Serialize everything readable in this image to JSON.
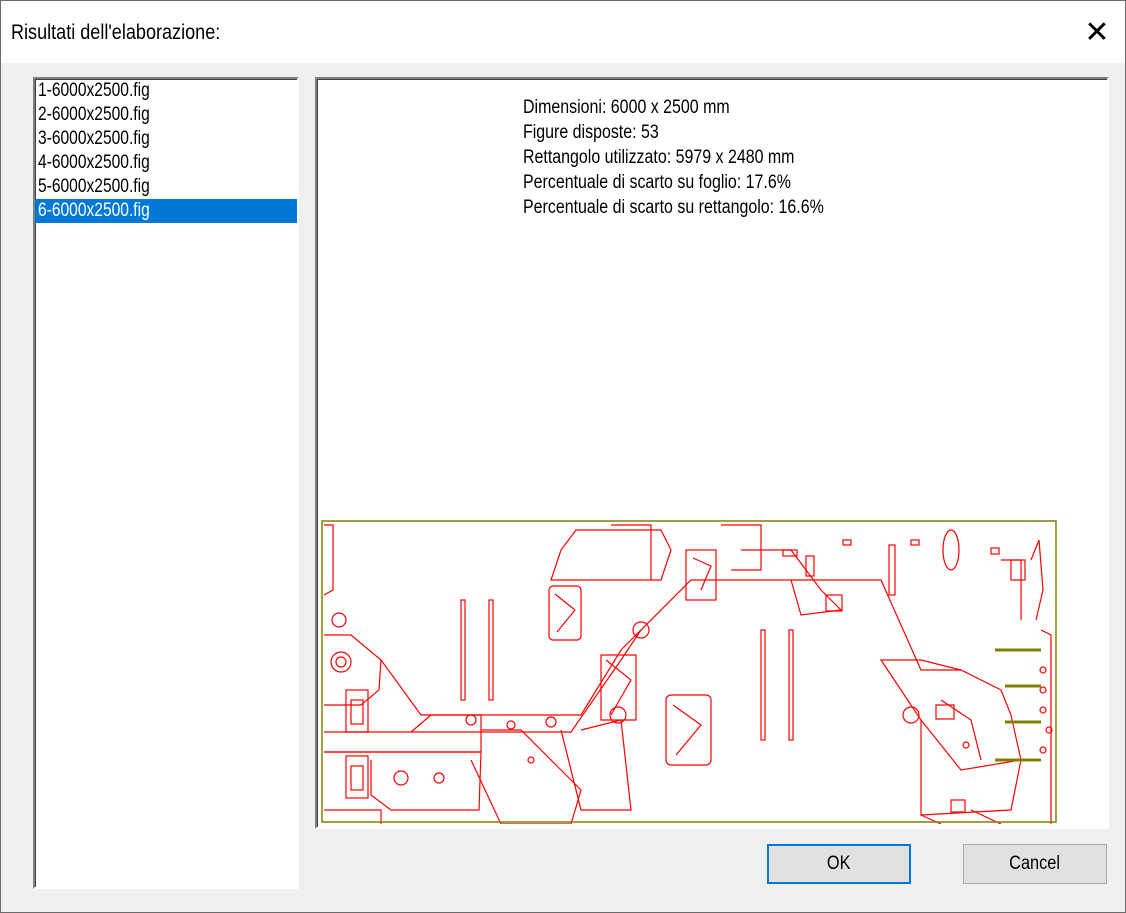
{
  "dialog": {
    "title": "Risultati dell'elaborazione:",
    "close_icon": "close-icon"
  },
  "list": {
    "items": [
      {
        "label": "1-6000x2500.fig",
        "selected": false
      },
      {
        "label": "2-6000x2500.fig",
        "selected": false
      },
      {
        "label": "3-6000x2500.fig",
        "selected": false
      },
      {
        "label": "4-6000x2500.fig",
        "selected": false
      },
      {
        "label": "5-6000x2500.fig",
        "selected": false
      },
      {
        "label": "6-6000x2500.fig",
        "selected": true
      }
    ]
  },
  "info": {
    "dimensions": "Dimensioni: 6000 x 2500 mm",
    "figures": "Figure disposte: 53",
    "rectangle": "Rettangolo utilizzato: 5979 x 2480 mm",
    "waste_sheet": "Percentuale di scarto su foglio: 17.6%",
    "waste_rectangle": "Percentuale di scarto su rettangolo: 16.6%"
  },
  "preview": {
    "sheet_color": "#808000",
    "part_color": "#ff0000"
  },
  "buttons": {
    "ok": "OK",
    "cancel": "Cancel"
  }
}
